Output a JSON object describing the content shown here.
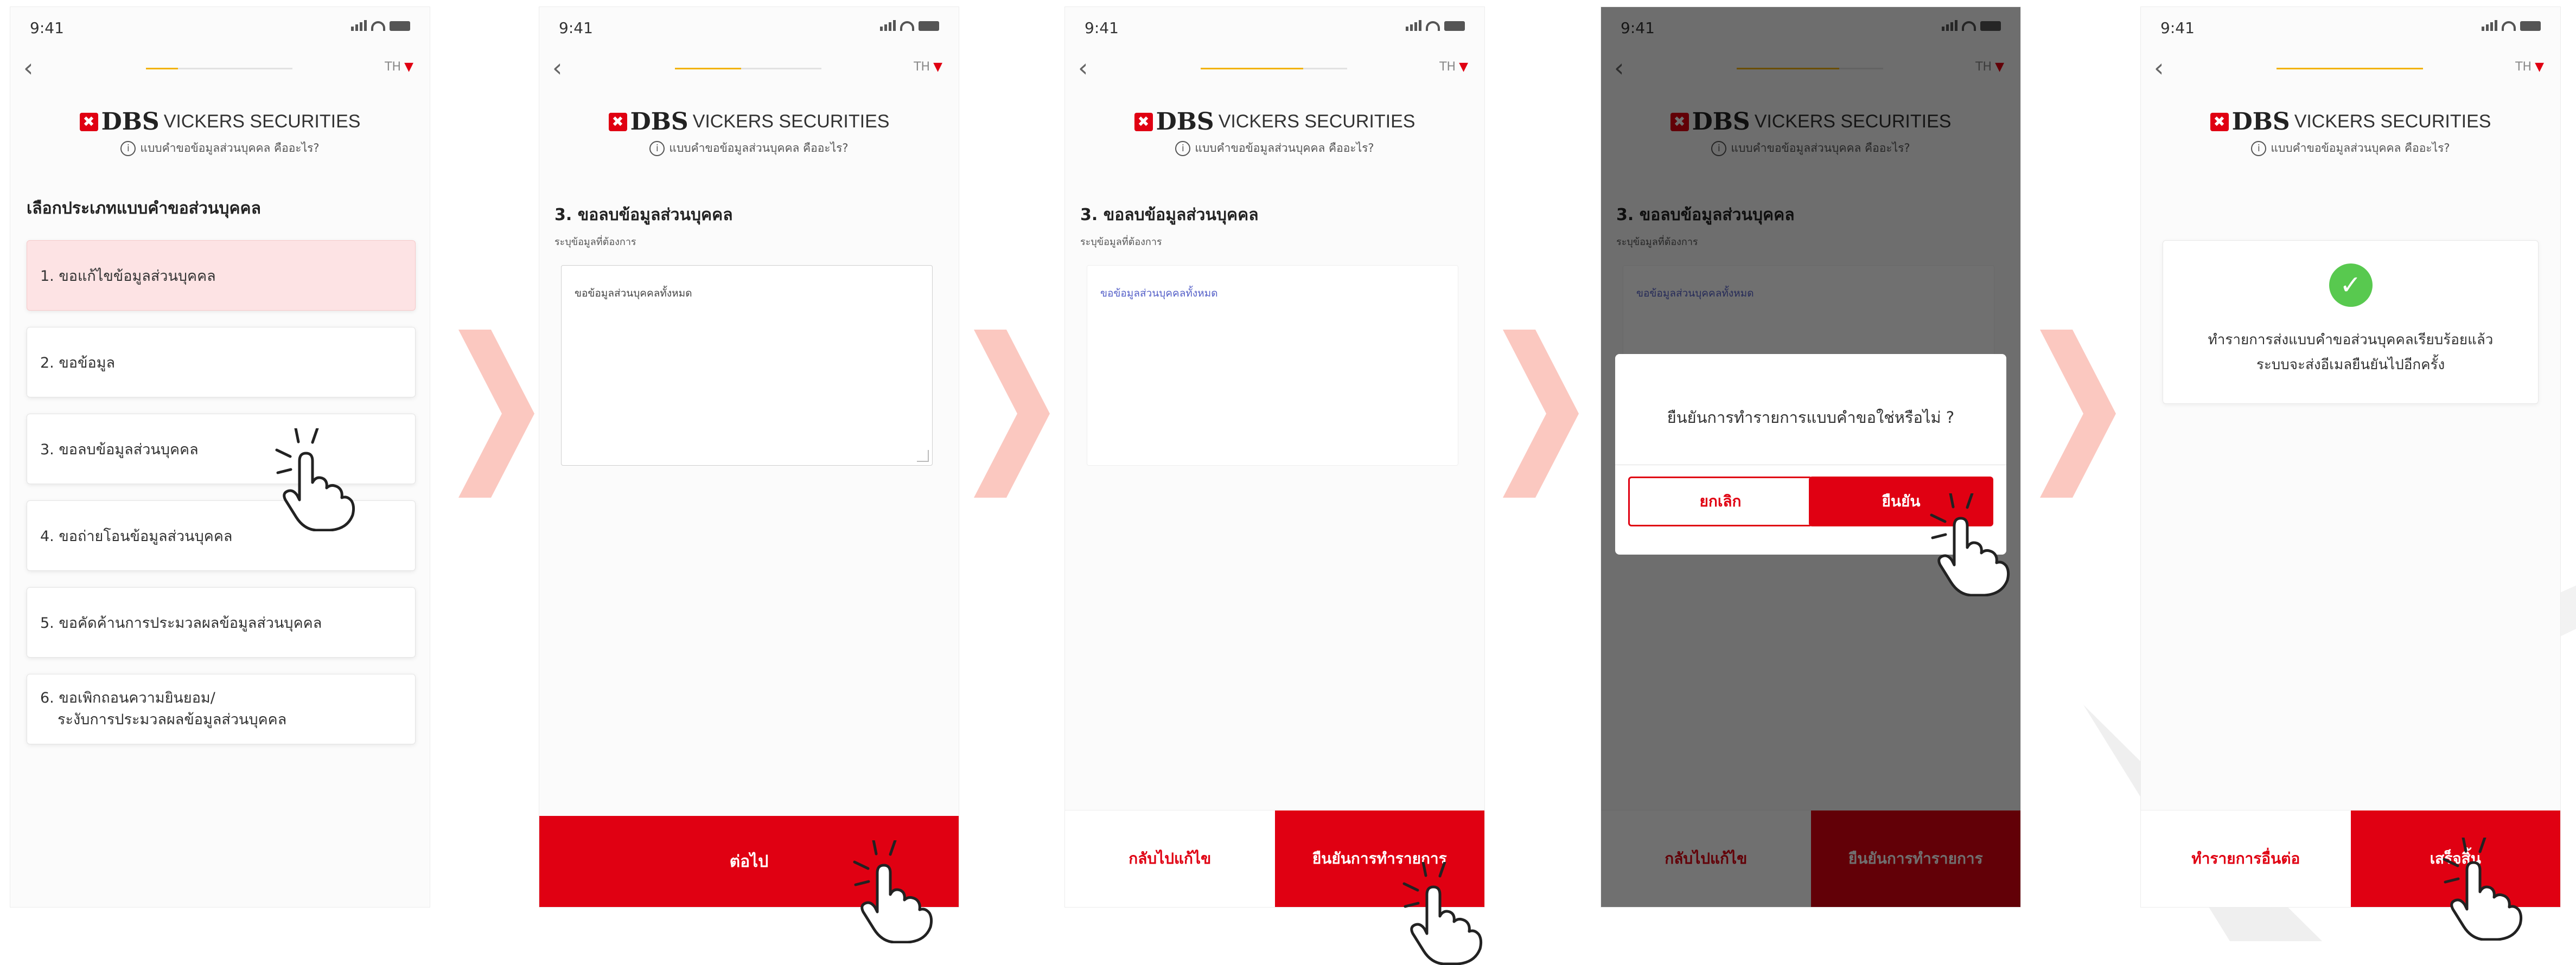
{
  "status": {
    "time": "9:41"
  },
  "header": {
    "lang": "TH",
    "brand_dbs": "DBS",
    "brand_vs": "VICKERS SECURITIES",
    "info_link": "แบบคำขอข้อมูลส่วนบุคคล คืออะไร?"
  },
  "screen1": {
    "title": "เลือกประเภทแบบคำขอส่วนบุคคล",
    "options": [
      {
        "label": "1. ขอแก้ไขข้อมูลส่วนบุคคล"
      },
      {
        "label": "2. ขอข้อมูล"
      },
      {
        "label": "3. ขอลบข้อมูลส่วนบุคคล"
      },
      {
        "label": "4. ขอถ่ายโอนข้อมูลส่วนบุคคล"
      },
      {
        "label": "5. ขอคัดค้านการประมวลผลข้อมูลส่วนบุคคล"
      },
      {
        "label_line1": "6. ขอเพิกถอนความยินยอม/",
        "label_line2": "ระงับการประมวลผลข้อมูลส่วนบุคคล"
      }
    ]
  },
  "form": {
    "title": "3. ขอลบข้อมูลส่วนบุคคล",
    "subtitle": "ระบุข้อมูลที่ต้องการ",
    "value": "ขอข้อมูลส่วนบุคคลทั้งหมด"
  },
  "screen2": {
    "next_button": "ต่อไป"
  },
  "screen3": {
    "back_button": "กลับไปแก้ไข",
    "confirm_button": "ยืนยันการทำรายการ"
  },
  "screen4": {
    "dialog_question": "ยืนยันการทำรายการแบบคำขอใช่หรือไม่ ?",
    "cancel_button": "ยกเลิก",
    "ok_button": "ยืนยัน"
  },
  "screen5": {
    "success_line1": "ทำรายการส่งแบบคำขอส่วนบุคคลเรียบร้อยแล้ว",
    "success_line2": "ระบบจะส่งอีเมลยืนยันไปอีกครั้ง",
    "another_button": "ทำรายการอื่นต่อ",
    "done_button": "เสร็จสิ้น"
  },
  "icons": {
    "back": "chevron-left-icon",
    "lang_dropdown": "chevron-down-icon",
    "info": "info-circle-icon",
    "success": "check-circle-icon",
    "flow": "chevron-right-arrow",
    "tap": "tap-hand-icon"
  },
  "colors": {
    "brand_red": "#e00012",
    "highlight": "#fde3e4",
    "arrow": "#fbc8c0",
    "progress": "#f2b200",
    "success_green": "#58c94f"
  }
}
